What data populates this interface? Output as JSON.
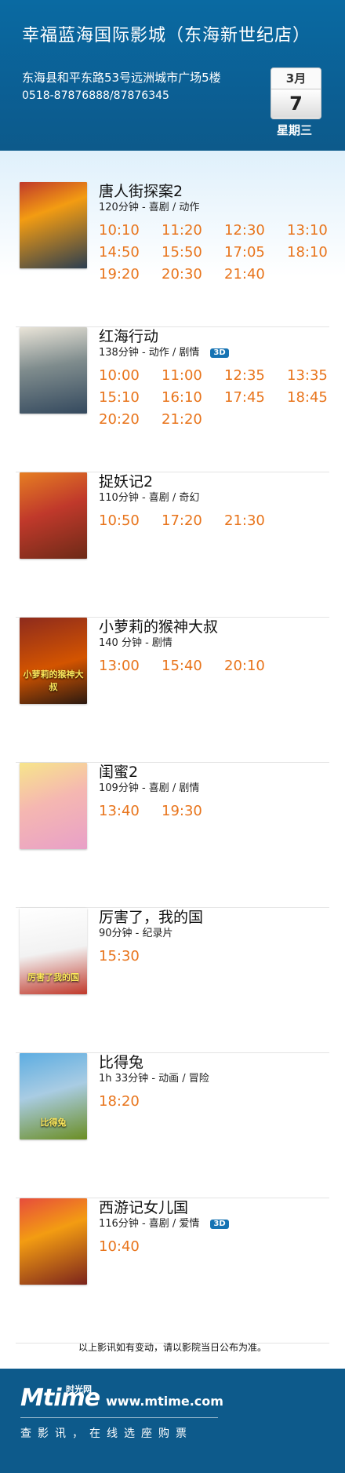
{
  "header": {
    "cinema_name": "幸福蓝海国际影城（东海新世纪店）",
    "address": "东海县和平东路53号远洲城市广场5楼",
    "phone": "0518-87876888/87876345",
    "date_month": "3月",
    "date_day": "7",
    "weekday": "星期三"
  },
  "movies": [
    {
      "title": "唐人街探案2",
      "meta": "120分钟 - 喜剧 / 动作",
      "badge": "",
      "poster_text": "",
      "times": [
        "10:10",
        "11:20",
        "12:30",
        "13:10",
        "14:50",
        "15:50",
        "17:05",
        "18:10",
        "19:20",
        "20:30",
        "21:40"
      ]
    },
    {
      "title": "红海行动",
      "meta": "138分钟 - 动作 / 剧情",
      "badge": "3D",
      "poster_text": "",
      "times": [
        "10:00",
        "11:00",
        "12:35",
        "13:35",
        "15:10",
        "16:10",
        "17:45",
        "18:45",
        "20:20",
        "21:20"
      ]
    },
    {
      "title": "捉妖记2",
      "meta": "110分钟 - 喜剧 / 奇幻",
      "badge": "",
      "poster_text": "",
      "times": [
        "10:50",
        "17:20",
        "21:30"
      ]
    },
    {
      "title": "小萝莉的猴神大叔",
      "meta": "140 分钟 - 剧情",
      "badge": "",
      "poster_text": "小萝莉的猴神大叔",
      "times": [
        "13:00",
        "15:40",
        "20:10"
      ]
    },
    {
      "title": "闺蜜2",
      "meta": "109分钟 - 喜剧 / 剧情",
      "badge": "",
      "poster_text": "",
      "times": [
        "13:40",
        "19:30"
      ]
    },
    {
      "title": "厉害了，我的国",
      "meta": "90分钟 - 纪录片",
      "badge": "",
      "poster_text": "厉害了我的国",
      "times": [
        "15:30"
      ]
    },
    {
      "title": "比得兔",
      "meta": "1h 33分钟 - 动画 / 冒险",
      "badge": "",
      "poster_text": "比得兔",
      "times": [
        "18:20"
      ]
    },
    {
      "title": "西游记女儿国",
      "meta": "116分钟 - 喜剧 / 爱情",
      "badge": "3D",
      "poster_text": "",
      "times": [
        "10:40"
      ]
    }
  ],
  "notice": "以上影讯如有变动，请以影院当日公布为准。",
  "footer": {
    "logo": "Mtime",
    "logo_cn": "时光网",
    "site": "www.mtime.com",
    "slogan": "查影讯，在线选座购票"
  },
  "colors": {
    "header_bg": "#0b5f94",
    "showtime": "#e8741b",
    "badge_3d": "#1673b3"
  }
}
